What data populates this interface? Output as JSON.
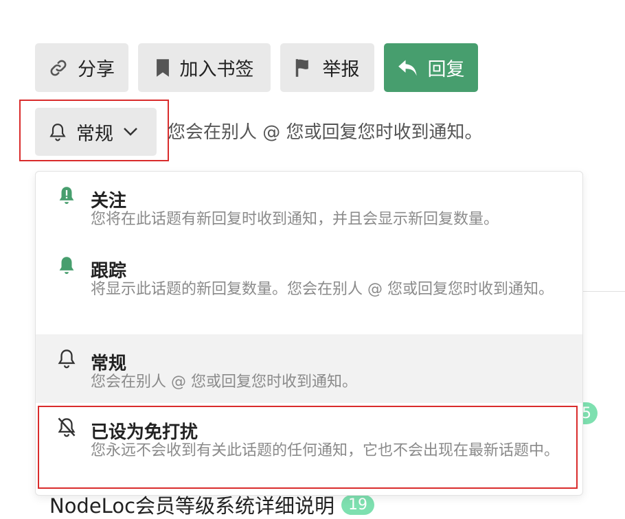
{
  "actions": {
    "share_label": "分享",
    "bookmark_label": "加入书签",
    "flag_label": "举报",
    "reply_label": "回复"
  },
  "notifications": {
    "current_level": "常规",
    "current_description": "您会在别人 @ 您或回复您时收到通知。",
    "options": [
      {
        "title": "关注",
        "description": "您将在此话题有新回复时收到通知，并且会显示新回复数量。",
        "icon": "bell-alert-icon"
      },
      {
        "title": "跟踪",
        "description": "将显示此话题的新回复数量。您会在别人 @ 您或回复您时收到通知。",
        "icon": "bell-filled-icon"
      },
      {
        "title": "常规",
        "description": "您会在别人 @ 您或回复您时收到通知。",
        "icon": "bell-outline-icon"
      },
      {
        "title": "已设为免打扰",
        "description": "您永远不会收到有关此话题的任何通知，它也不会出现在最新话题中。",
        "icon": "bell-slash-icon"
      }
    ]
  },
  "background": {
    "badge_partial": "5",
    "topic_title": "NodeLoc会员等级系统详细说明",
    "topic_count": "19"
  },
  "colors": {
    "accent": "#479e6e",
    "highlight": "#d92b2b",
    "badge": "#7ee0b0"
  }
}
